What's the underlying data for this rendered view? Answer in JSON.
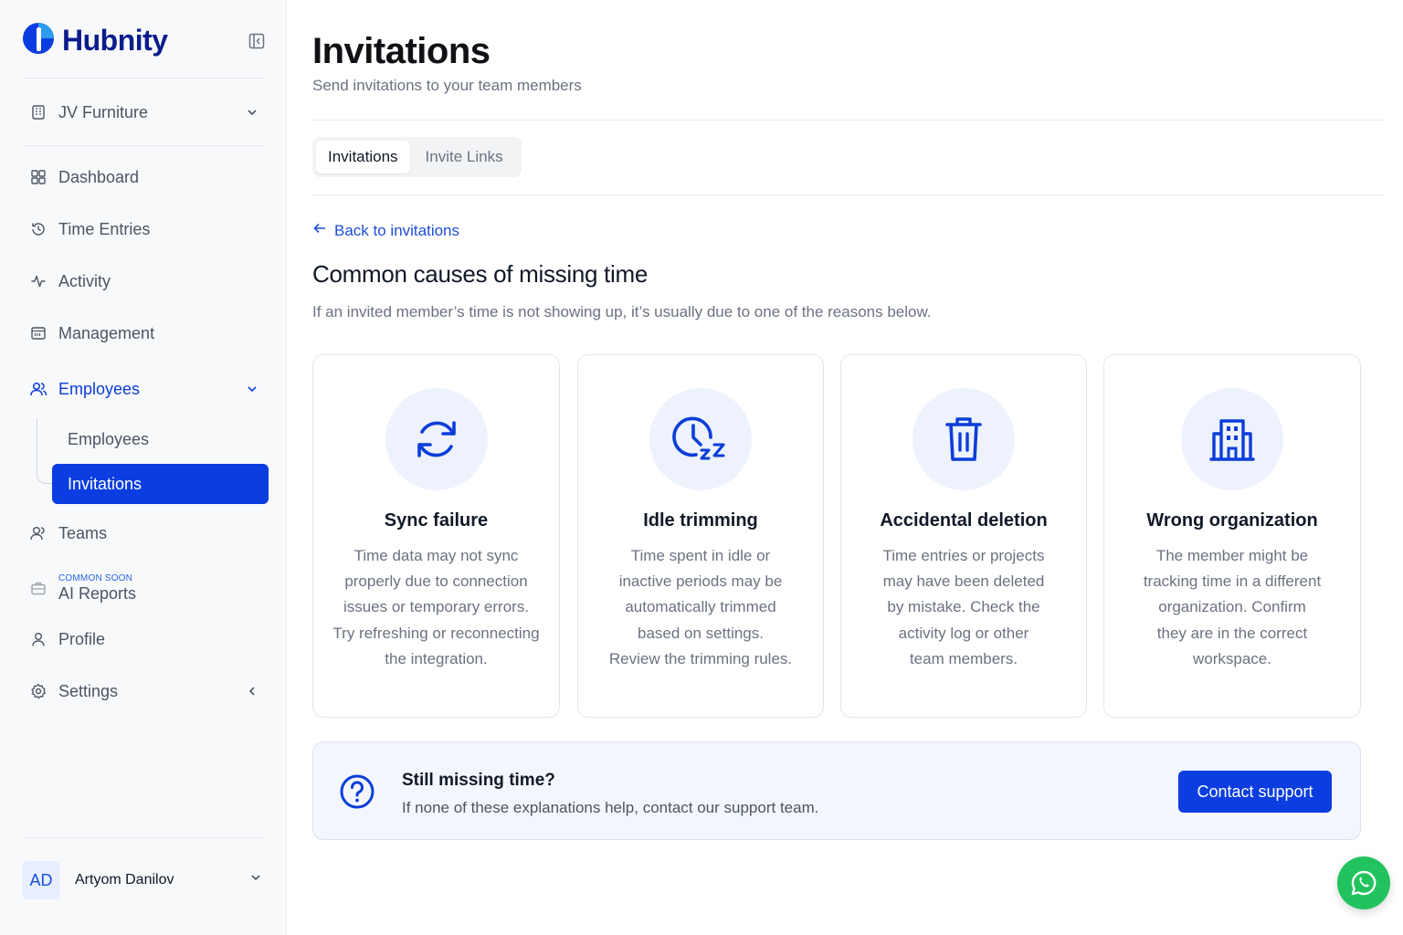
{
  "brand": {
    "name": "Hubnity"
  },
  "workspace": {
    "label": "JV Furniture"
  },
  "sidebar": {
    "items": [
      {
        "label": "Dashboard",
        "icon": "grid-icon"
      },
      {
        "label": "Time Entries",
        "icon": "history-icon"
      },
      {
        "label": "Activity",
        "icon": "activity-icon"
      },
      {
        "label": "Management",
        "icon": "calendar-icon"
      },
      {
        "label": "Employees",
        "icon": "users-icon"
      },
      {
        "label": "Teams",
        "icon": "team-icon"
      },
      {
        "label": "AI Reports",
        "badge": "COMMON SOON",
        "icon": "briefcase-icon"
      },
      {
        "label": "Profile",
        "icon": "user-icon"
      },
      {
        "label": "Settings",
        "icon": "gear-icon"
      }
    ],
    "employees_sub": [
      {
        "label": "Employees"
      },
      {
        "label": "Invitations"
      }
    ]
  },
  "user": {
    "initials": "AD",
    "name": "Artyom Danilov"
  },
  "header": {
    "title": "Invitations",
    "subtitle": "Send invitations to your team members"
  },
  "tabs": [
    {
      "label": "Invitations",
      "active": true
    },
    {
      "label": "Invite Links",
      "active": false
    }
  ],
  "back_link": "Back to invitations",
  "section": {
    "title": "Common causes of missing time",
    "description": "If an invited member’s time is not showing up, it’s usually due to one of the reasons below."
  },
  "cards": [
    {
      "title": "Sync failure",
      "icon": "sync-icon",
      "lines": [
        "Time data may not sync",
        "properly due to connection",
        "issues or temporary errors.",
        "Try refreshing or reconnecting",
        "the integration."
      ]
    },
    {
      "title": "Idle trimming",
      "icon": "clock-sleep-icon",
      "lines": [
        "Time spent in idle or",
        "inactive periods may be",
        "automatically trimmed",
        "based on settings.",
        "Review the trimming rules."
      ]
    },
    {
      "title": "Accidental deletion",
      "icon": "trash-icon",
      "lines": [
        "Time entries or projects",
        "may have been deleted",
        "by mistake. Check the",
        "activity log or other",
        "team members."
      ]
    },
    {
      "title": "Wrong organization",
      "icon": "building-icon",
      "lines": [
        "The member might be",
        "tracking time in a different",
        "organization. Confirm",
        "they are in the correct",
        "workspace."
      ]
    }
  ],
  "help": {
    "title": "Still missing time?",
    "text": "If none of these explanations help, contact our support team.",
    "button": "Contact support"
  },
  "colors": {
    "accent": "#0b3de0",
    "brand_text": "#0c1c8c",
    "whatsapp": "#22c35e"
  }
}
